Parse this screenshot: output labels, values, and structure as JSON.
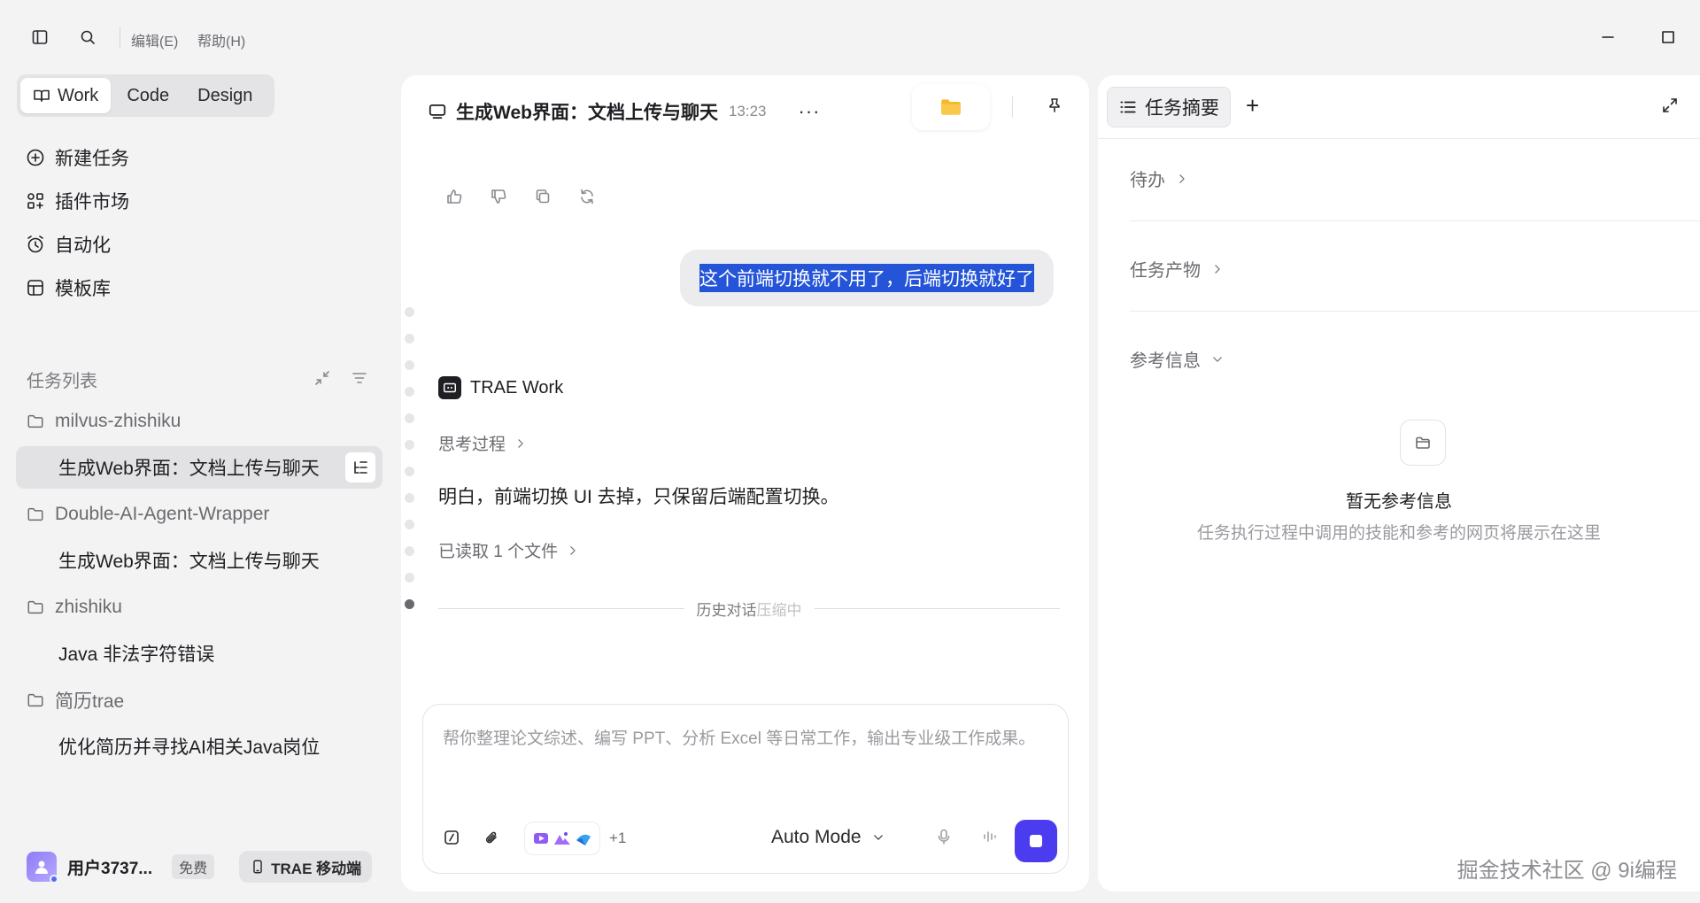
{
  "menu": {
    "edit": "编辑(E)",
    "help": "帮助(H)"
  },
  "modes": [
    {
      "label": "Work",
      "active": true
    },
    {
      "label": "Code",
      "active": false
    },
    {
      "label": "Design",
      "active": false
    }
  ],
  "nav": {
    "new_task": "新建任务",
    "plugins": "插件市场",
    "automation": "自动化",
    "templates": "模板库"
  },
  "task_list": {
    "title": "任务列表",
    "folders": [
      {
        "name": "milvus-zhishiku",
        "tasks": [
          "生成Web界面：文档上传与聊天"
        ]
      },
      {
        "name": "Double-AI-Agent-Wrapper",
        "tasks": [
          "生成Web界面：文档上传与聊天"
        ]
      },
      {
        "name": "zhishiku",
        "tasks": [
          "Java 非法字符错误"
        ]
      },
      {
        "name": "简历trae",
        "tasks": [
          "优化简历并寻找AI相关Java岗位"
        ]
      }
    ]
  },
  "user": {
    "name": "用户3737...",
    "plan": "免费",
    "mobile": "TRAE 移动端"
  },
  "chat": {
    "title": "生成Web界面：文档上传与聊天",
    "time": "13:23",
    "more": "···",
    "user_message": "这个前端切换就不用了，后端切换就好了",
    "agent_name": "TRAE Work",
    "thinking": "思考过程",
    "answer": "明白，前端切换 UI 去掉，只保留后端配置切换。",
    "read_files": "已读取 1 个文件",
    "compress_a": "历史对话",
    "compress_b": "压缩中",
    "composer_placeholder": "帮你整理论文综述、编写 PPT、分析 Excel 等日常工作，输出专业级工作成果。",
    "extra_skills": "+1",
    "mode": "Auto Mode"
  },
  "right": {
    "tab": "任务摘要",
    "add": "+",
    "todo": "待办",
    "outputs": "任务产物",
    "references": "参考信息",
    "empty_title": "暂无参考信息",
    "empty_desc": "任务执行过程中调用的技能和参考的网页将展示在这里"
  },
  "watermark": "掘金技术社区 @ 9i编程",
  "colors": {
    "accent": "#4b3cf0",
    "selection": "#2454d8",
    "folder": "#f5b82e"
  }
}
